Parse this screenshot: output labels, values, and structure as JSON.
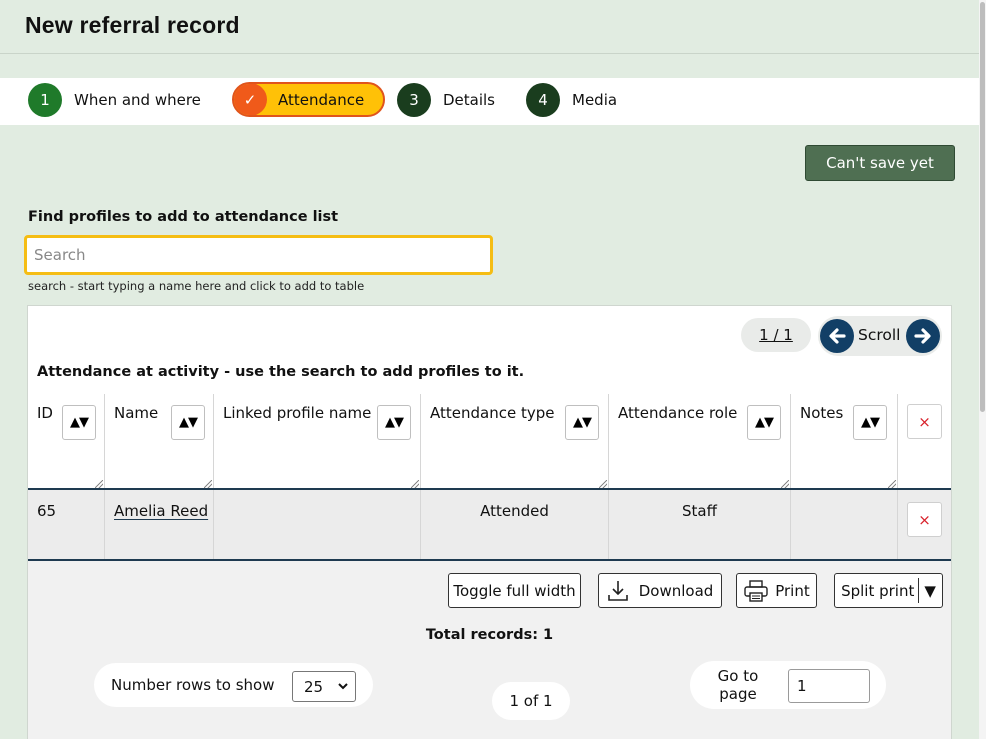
{
  "page": {
    "title": "New referral record"
  },
  "steps": [
    {
      "num": "1",
      "label": "When and where",
      "state": "complete"
    },
    {
      "num": "✓",
      "label": "Attendance",
      "state": "current"
    },
    {
      "num": "3",
      "label": "Details",
      "state": "upcoming"
    },
    {
      "num": "4",
      "label": "Media",
      "state": "upcoming"
    }
  ],
  "save_button": {
    "label": "Can't save yet"
  },
  "search": {
    "label": "Find profiles to add to attendance list",
    "placeholder": "Search",
    "hint": "search - start typing a name here and click to add to table"
  },
  "table": {
    "pager": "1 / 1",
    "scroll_label": "Scroll",
    "caption": "Attendance at activity - use the search to add profiles to it.",
    "columns": [
      "ID",
      "Name",
      "Linked profile name",
      "Attendance type",
      "Attendance role",
      "Notes"
    ],
    "sort_icon": "▲▼",
    "delete_icon": "×",
    "rows": [
      {
        "id": "65",
        "name": "Amelia Reed",
        "linked_profile": "",
        "attendance_type": "Attended",
        "attendance_role": "Staff",
        "notes": ""
      }
    ]
  },
  "toolbar": {
    "toggle_label": "Toggle full width",
    "download_label": "Download",
    "print_label": "Print",
    "split_print_label": "Split print",
    "split_caret": "▼"
  },
  "summary": {
    "total": "Total records: 1"
  },
  "pagination": {
    "rows_label": "Number rows to show",
    "rows_value": "25",
    "page_info": "1 of 1",
    "goto_label": "Go to page",
    "goto_value": "1"
  },
  "colors": {
    "background": "#e1ece1",
    "step_complete": "#1f7a2a",
    "step_upcoming": "#1a3d1e",
    "step_current_fill": "#ffc107",
    "step_current_border": "#e0541c",
    "save_button": "#4f6f52",
    "search_focus": "#f5bd14",
    "scroll_arrows": "#123f66",
    "delete_icon": "#d8202a"
  }
}
